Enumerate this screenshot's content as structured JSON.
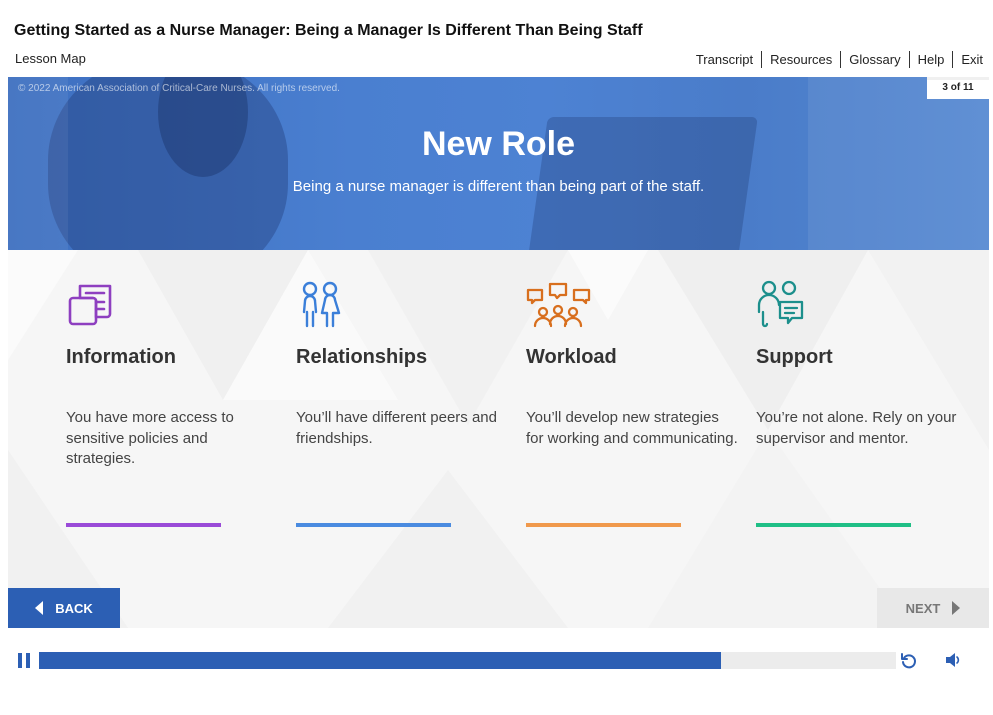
{
  "header": {
    "course_title": "Getting Started as a Nurse Manager: Being a Manager Is Different Than Being Staff",
    "lesson_map": "Lesson Map",
    "nav": [
      "Transcript",
      "Resources",
      "Glossary",
      "Help",
      "Exit"
    ]
  },
  "slide": {
    "copyright": "© 2022 American Association of Critical-Care Nurses. All rights reserved.",
    "counter": "3 of 11",
    "title": "New Role",
    "subtitle": "Being a nurse manager is different than being part of the staff.",
    "cards": [
      {
        "title": "Information",
        "text": "You have more access to sensitive policies and strategies.",
        "icon": "documents-icon",
        "color": "#8e3fc0"
      },
      {
        "title": "Relationships",
        "text": "You’ll have different peers and friendships.",
        "icon": "people-icon",
        "color": "#3b7fd9"
      },
      {
        "title": "Workload",
        "text": "You’ll develop new strategies for working and communicating.",
        "icon": "team-chat-icon",
        "color": "#d86f1e"
      },
      {
        "title": "Support",
        "text": "You’re not alone. Rely on your supervisor and mentor.",
        "icon": "support-icon",
        "color": "#1c8f8c"
      }
    ],
    "bar_colors": [
      "#9a4bd8",
      "#4a8be0",
      "#f0994c",
      "#1fbf86"
    ]
  },
  "controls": {
    "back": "BACK",
    "next": "NEXT"
  },
  "player": {
    "progress": 0.796
  },
  "colors": {
    "accent": "#2c5fb4",
    "hero": "#4a7fd0"
  }
}
